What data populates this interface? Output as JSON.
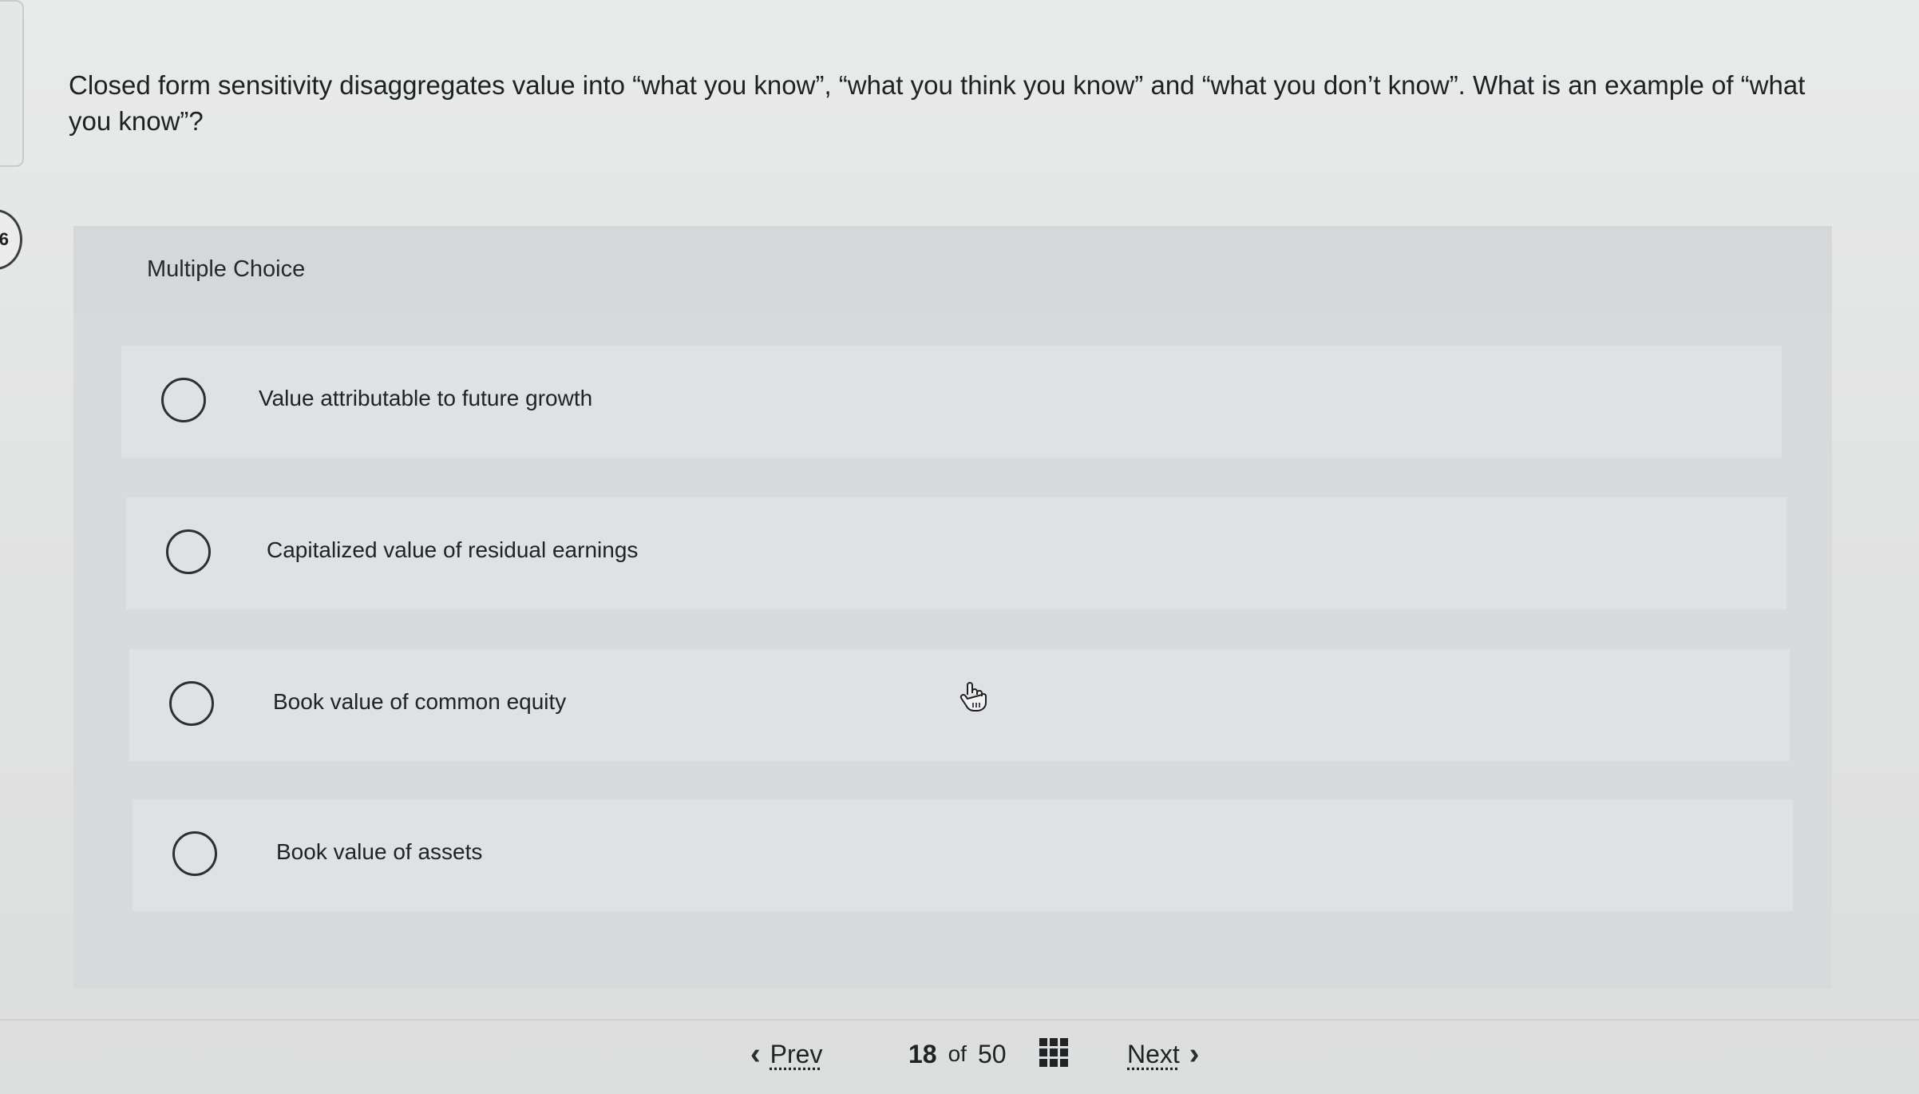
{
  "question": {
    "number": "6",
    "text": "Closed form sensitivity disaggregates value into “what you know”, “what you think you know” and “what you don’t know”. What is an example of “what you know”?"
  },
  "choices": {
    "title": "Multiple Choice",
    "options": [
      {
        "label": "Value attributable to future growth",
        "selected": false
      },
      {
        "label": "Capitalized value of residual earnings",
        "selected": false
      },
      {
        "label": "Book value of common equity",
        "selected": false
      },
      {
        "label": "Book value of assets",
        "selected": false
      }
    ]
  },
  "navigation": {
    "prev_label": "Prev",
    "prev_icon": "chevron-left-icon",
    "current": "18",
    "of_label": "of",
    "total": "50",
    "grid_icon": "grid-icon",
    "next_label": "Next",
    "next_icon": "chevron-right-icon"
  },
  "icons": {
    "cursor": "hand-pointer-icon",
    "radio": "radio-unchecked-icon"
  }
}
